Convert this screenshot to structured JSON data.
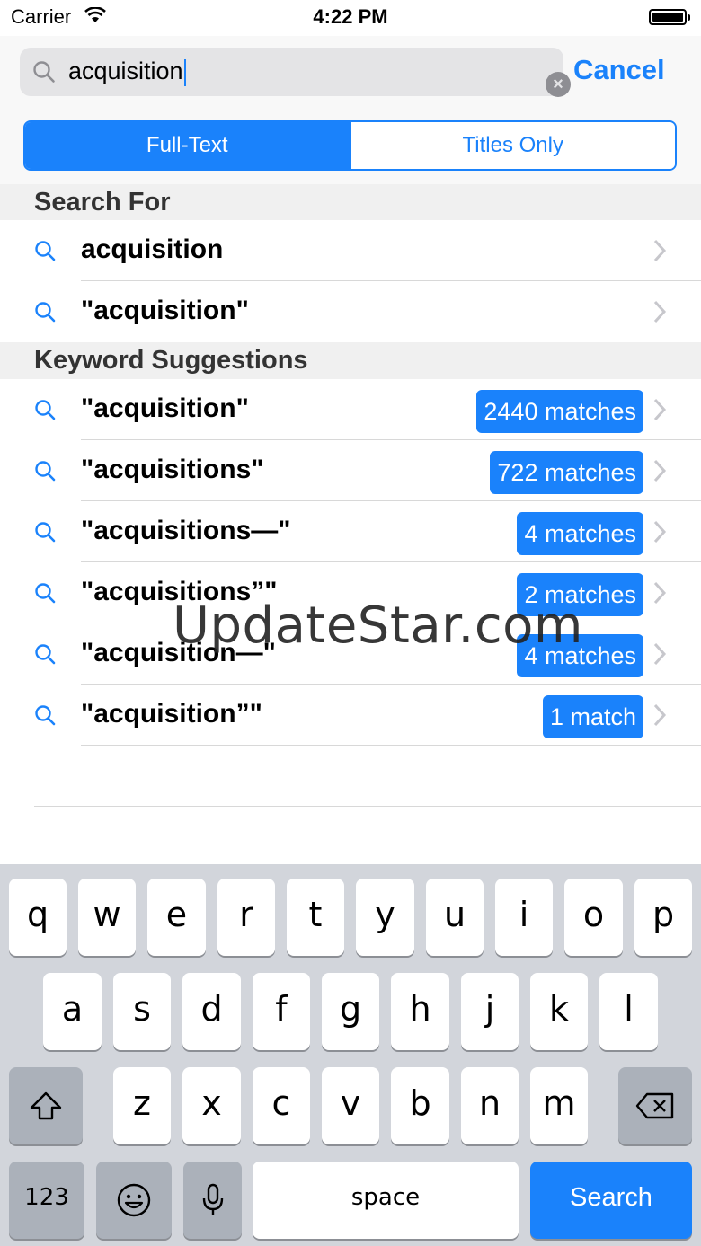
{
  "status_bar": {
    "carrier": "Carrier",
    "time": "4:22 PM"
  },
  "search": {
    "query": "acquisition",
    "cancel_label": "Cancel"
  },
  "segments": {
    "full_text": "Full-Text",
    "titles_only": "Titles Only",
    "selected": "Full-Text"
  },
  "search_for": {
    "header": "Search For",
    "items": [
      {
        "label": "acquisition"
      },
      {
        "label": "\"acquisition\""
      }
    ]
  },
  "keyword_suggestions": {
    "header": "Keyword Suggestions",
    "items": [
      {
        "label": "\"acquisition\"",
        "badge": "2440 matches"
      },
      {
        "label": "\"acquisitions\"",
        "badge": "722 matches"
      },
      {
        "label": "\"acquisitions—\"",
        "badge": "4 matches"
      },
      {
        "label": "\"acquisitions”\"",
        "badge": "2 matches"
      },
      {
        "label": "\"acquisition—\"",
        "badge": "4 matches"
      },
      {
        "label": "\"acquisition”\"",
        "badge": "1 match"
      }
    ]
  },
  "watermark": "UpdateStar.com",
  "keyboard": {
    "row1": [
      "q",
      "w",
      "e",
      "r",
      "t",
      "y",
      "u",
      "i",
      "o",
      "p"
    ],
    "row2": [
      "a",
      "s",
      "d",
      "f",
      "g",
      "h",
      "j",
      "k",
      "l"
    ],
    "row3": [
      "z",
      "x",
      "c",
      "v",
      "b",
      "n",
      "m"
    ],
    "numbers_label": "123",
    "space_label": "space",
    "search_label": "Search"
  },
  "colors": {
    "accent": "#1a82fb",
    "keyboard_bg": "#d2d5db"
  }
}
